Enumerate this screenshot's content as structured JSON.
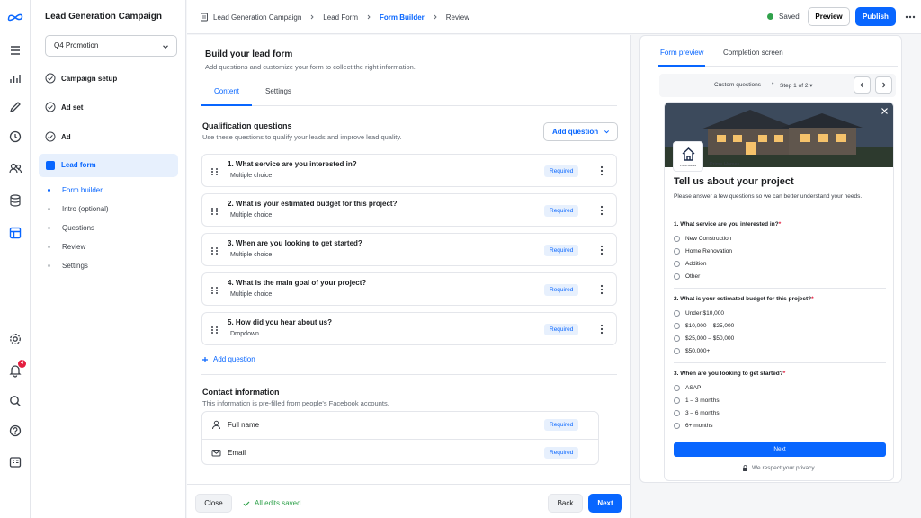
{
  "sidebar": {
    "title": "Lead Generation Campaign",
    "campaign_select": "Q4 Promotion",
    "steps": [
      {
        "label": "Campaign setup"
      },
      {
        "label": "Ad set"
      },
      {
        "label": "Ad"
      }
    ],
    "active_step": "Lead form",
    "substeps": [
      "Form builder",
      "Intro (optional)",
      "Questions",
      "Review",
      "Settings"
    ]
  },
  "rail": {
    "notification_count": "4"
  },
  "header": {
    "breadcrumbs": [
      "Lead Generation Campaign",
      "Lead Form",
      "Form Builder",
      "Review"
    ],
    "status": "Saved",
    "preview_label": "Preview",
    "publish_label": "Publish"
  },
  "main": {
    "title": "Build your lead form",
    "subtitle": "Add questions and customize your form to collect the right information.",
    "tabs": [
      "Content",
      "Settings"
    ],
    "qualification": {
      "title": "Qualification questions",
      "description": "Use these questions to qualify your leads and improve lead quality.",
      "add_button": "Add question",
      "questions": [
        {
          "title": "1. What service are you interested in?",
          "type": "Multiple choice",
          "badge": "Required"
        },
        {
          "title": "2. What is your estimated budget for this project?",
          "type": "Multiple choice",
          "badge": "Required"
        },
        {
          "title": "3. When are you looking to get started?",
          "type": "Multiple choice",
          "badge": "Required"
        },
        {
          "title": "4. What is the main goal of your project?",
          "type": "Multiple choice",
          "badge": "Required"
        },
        {
          "title": "5. How did you hear about us?",
          "type": "Dropdown",
          "badge": "Required"
        }
      ],
      "add_link": "Add question"
    },
    "contact": {
      "title": "Contact information",
      "description": "This information is pre-filled from people's Facebook accounts.",
      "fields": [
        {
          "label": "Full name",
          "badge": "Required"
        },
        {
          "label": "Email",
          "badge": "Required"
        }
      ]
    }
  },
  "footer": {
    "close_label": "Close",
    "status": "All edits saved",
    "back_label": "Back",
    "next_label": "Next"
  },
  "preview": {
    "tabs": [
      "Form preview",
      "Completion screen"
    ],
    "section_label": "Custom questions",
    "step_label": "Step 1 of 2",
    "logo_text": "Prime Homes",
    "brand": "Prime Homes",
    "title": "Tell us about your project",
    "description": "Please answer a few questions so we can better understand your needs.",
    "questions": [
      {
        "label": "1. What service are you interested in?",
        "options": [
          "New Construction",
          "Home Renovation",
          "Addition",
          "Other"
        ]
      },
      {
        "label": "2. What is your estimated budget for this project?",
        "options": [
          "Under $10,000",
          "$10,000 – $25,000",
          "$25,000 – $50,000",
          "$50,000+"
        ]
      },
      {
        "label": "3. When are you looking to get started?",
        "options": [
          "ASAP",
          "1 – 3 months",
          "3 – 6 months",
          "6+ months"
        ]
      }
    ],
    "next_label": "Next",
    "privacy": "We respect your privacy."
  },
  "colors": {
    "accent": "#0866ff",
    "success": "#31a24c",
    "required_bg": "#e7f0fd",
    "alert": "#e41e3f"
  }
}
